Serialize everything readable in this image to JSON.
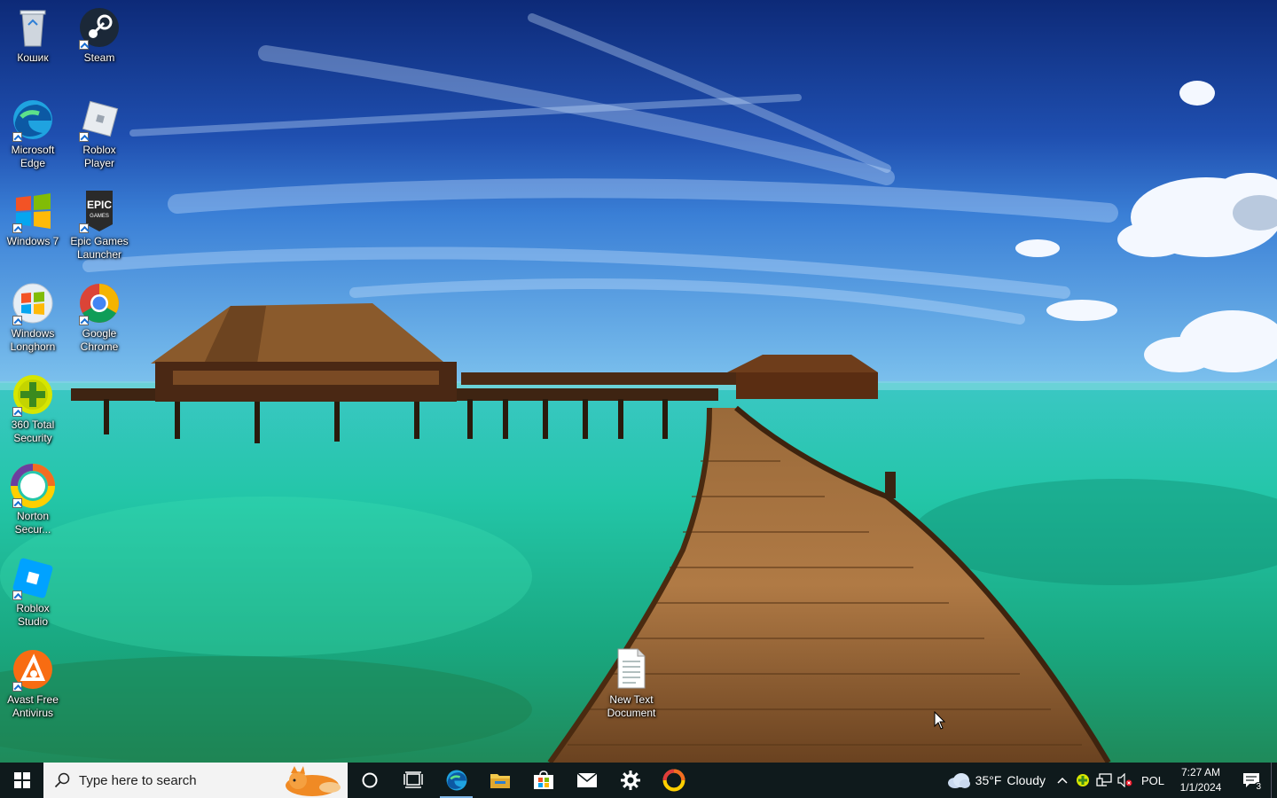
{
  "desktop": {
    "icons": [
      {
        "id": "recycle",
        "label": "Кошик"
      },
      {
        "id": "steam",
        "label": "Steam"
      },
      {
        "id": "edge",
        "label": "Microsoft Edge"
      },
      {
        "id": "roblox-player",
        "label": "Roblox Player"
      },
      {
        "id": "windows7",
        "label": "Windows 7"
      },
      {
        "id": "epic",
        "label": "Epic Games Launcher"
      },
      {
        "id": "longhorn",
        "label": "Windows Longhorn"
      },
      {
        "id": "chrome",
        "label": "Google Chrome"
      },
      {
        "id": "360",
        "label": "360 Total Security"
      },
      {
        "id": "norton",
        "label": "Norton Secur..."
      },
      {
        "id": "roblox-studio",
        "label": "Roblox Studio"
      },
      {
        "id": "avast",
        "label": "Avast Free Antivirus"
      },
      {
        "id": "textdoc",
        "label": "New Text Document"
      }
    ],
    "epic_logo_text": [
      "EPIC",
      "GAMES"
    ]
  },
  "taskbar": {
    "search_placeholder": "Type here to search",
    "pinned": [
      "start-icon",
      "cortana-icon",
      "task-view-icon",
      "edge-icon",
      "file-explorer-icon",
      "store-icon",
      "mail-icon",
      "settings-icon",
      "norton-icon"
    ],
    "weather": {
      "temp": "35°F",
      "condition": "Cloudy"
    },
    "language": "POL",
    "time": "7:27 AM",
    "date": "1/1/2024",
    "notification_count": "3"
  },
  "colors": {
    "taskbar_bg": "#0f1a1c",
    "accent": "#7fb5e6"
  }
}
